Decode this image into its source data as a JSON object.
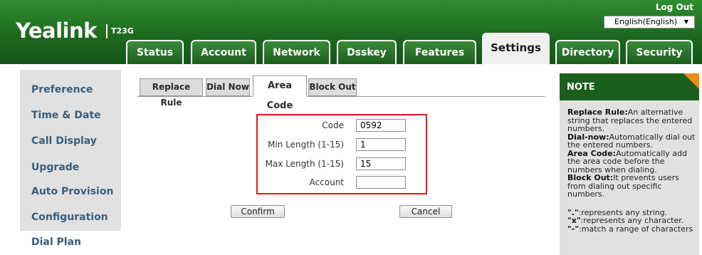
{
  "brand": {
    "logo": "Yealink",
    "model": "T23G"
  },
  "header": {
    "logout": "Log Out",
    "language": "English(English)"
  },
  "tabs": [
    {
      "label": "Status"
    },
    {
      "label": "Account"
    },
    {
      "label": "Network"
    },
    {
      "label": "Dsskey"
    },
    {
      "label": "Features"
    },
    {
      "label": "Settings"
    },
    {
      "label": "Directory"
    },
    {
      "label": "Security"
    }
  ],
  "sidebar": {
    "items": [
      {
        "label": "Preference"
      },
      {
        "label": "Time & Date"
      },
      {
        "label": "Call Display"
      },
      {
        "label": "Upgrade"
      },
      {
        "label": "Auto Provision"
      },
      {
        "label": "Configuration"
      },
      {
        "label": "Dial Plan"
      }
    ]
  },
  "subtabs": [
    {
      "label": "Replace Rule"
    },
    {
      "label": "Dial Now"
    },
    {
      "label": "Area Code"
    },
    {
      "label": "Block Out"
    }
  ],
  "form": {
    "code_label": "Code",
    "code_value": "0592",
    "min_label": "Min Length (1-15)",
    "min_value": "1",
    "max_label": "Max Length (1-15)",
    "max_value": "15",
    "account_label": "Account",
    "account_value": "",
    "confirm": "Confirm",
    "cancel": "Cancel"
  },
  "note": {
    "title": "NOTE",
    "replace_rule_term": "Replace Rule:",
    "replace_rule_text": "An alternative string that replaces the entered numbers.",
    "dial_now_term": "Dial-now:",
    "dial_now_text": "Automatically dial out the entered numbers.",
    "area_code_term": "Area Code:",
    "area_code_text": "Automatically add the area code before the numbers when dialing.",
    "block_out_term": "Block Out:",
    "block_out_text": "It prevents users from dialing out specific numbers.",
    "dot_term": "\".\"",
    "dot_text": ":represents any string.",
    "x_term": "\"x\"",
    "x_text": ":represents any character.",
    "dash_term": "\"-\"",
    "dash_text": ":match a range of characters"
  },
  "colors": {
    "header_green": "#1d6a1f",
    "note_accent": "#f08a1a",
    "highlight_red": "#e01b1b"
  }
}
